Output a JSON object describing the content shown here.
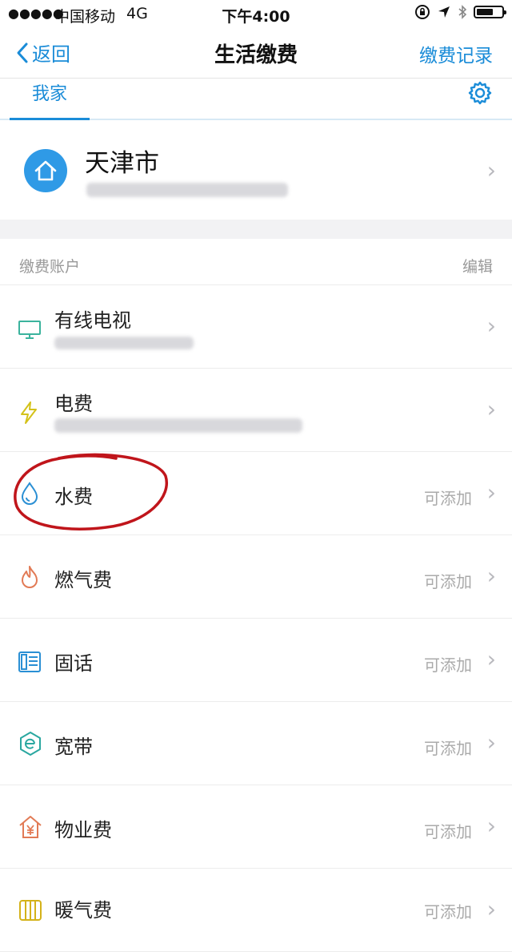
{
  "status_bar": {
    "signal": "●●●●●",
    "carrier": "中国移动",
    "network": "4G",
    "time": "下午4:00"
  },
  "nav": {
    "back_label": "返回",
    "title": "生活缴费",
    "record_label": "缴费记录"
  },
  "tab": {
    "home_label": "我家"
  },
  "city": {
    "name": "天津市"
  },
  "section": {
    "title": "缴费账户",
    "edit_label": "编辑"
  },
  "accounts": [
    {
      "label": "有线电视",
      "icon": "tv-icon",
      "status": ""
    },
    {
      "label": "电费",
      "icon": "lightning-icon",
      "status": ""
    },
    {
      "label": "水费",
      "icon": "water-drop-icon",
      "status": "可添加"
    },
    {
      "label": "燃气费",
      "icon": "flame-icon",
      "status": "可添加"
    },
    {
      "label": "固话",
      "icon": "phone-icon",
      "status": "可添加"
    },
    {
      "label": "宽带",
      "icon": "broadband-icon",
      "status": "可添加"
    },
    {
      "label": "物业费",
      "icon": "property-icon",
      "status": "可添加"
    },
    {
      "label": "暖气费",
      "icon": "heater-icon",
      "status": "可添加"
    }
  ],
  "colors": {
    "accent": "#1a8cd8",
    "annotation_circle": "#c0151b"
  }
}
